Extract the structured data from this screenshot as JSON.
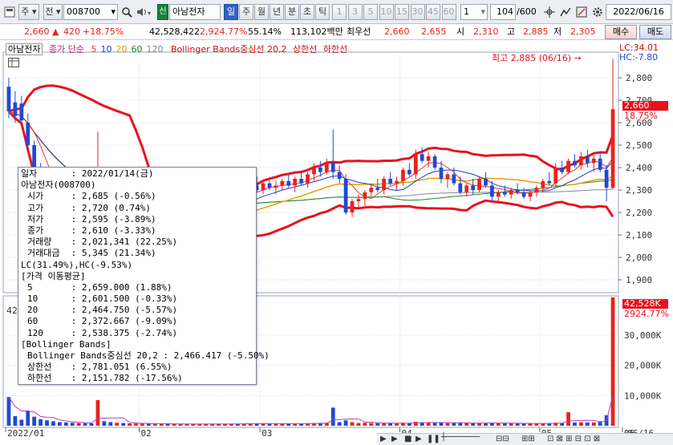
{
  "toolbar": {
    "market": "주",
    "prev": "전",
    "code": "008700",
    "new_badge": "신",
    "name": "아남전자",
    "periods": [
      "일",
      "주",
      "월",
      "년",
      "분",
      "초",
      "틱"
    ],
    "active_period": "일",
    "intervals": [
      "1",
      "3",
      "5",
      "10",
      "15",
      "30",
      "45",
      "60"
    ],
    "interval_value": "1",
    "count": "104",
    "count_max": "/600",
    "date": "2022/06/16"
  },
  "quote": {
    "price": "2,660",
    "change": "420",
    "change_pct": "+18.75%",
    "volume": "42,528,422",
    "volume_pct": "2,924.77%",
    "turnover": "55.14%",
    "amount": "113,102백만",
    "best_ask_label": "최우선",
    "best_ask": "2,660",
    "best_bid": "2,655",
    "open_label": "시",
    "open": "2,310",
    "high_label": "고",
    "high": "2,885",
    "low_label": "저",
    "low": "2,305",
    "buy": "매수",
    "sell": "매도"
  },
  "legend": {
    "stock": "아남전자",
    "ma_label": "종가 단순",
    "ma": [
      "5",
      "10",
      "20",
      "60",
      "120"
    ],
    "bb": "Bollinger Bands중심선 20,2",
    "upper": "상한선",
    "lower": "하한선"
  },
  "annotations": {
    "high_marker": "최고 2,885 (06/16)",
    "lc": "LC:34.01",
    "hc": "HC:-7.80",
    "price_tag": "2,660",
    "price_pct": "18.75%",
    "vol_tag": "42,528K",
    "vol_pct": "2924.77%",
    "vol_side": "42"
  },
  "axes": {
    "price_ticks": [
      "2,800",
      "2,700",
      "2,600",
      "2,500",
      "2,400",
      "2,300",
      "2,200",
      "2,100",
      "2,000",
      "1,900"
    ],
    "volume_ticks": [
      "30,000K",
      "20,000K",
      "10,000K"
    ],
    "x_ticks": [
      "2022/01",
      "02",
      "03",
      "04",
      "05",
      "06"
    ],
    "x_end": "06/16"
  },
  "info": {
    "date_label": "일자",
    "date": "2022/01/14(금)",
    "stock": "아남전자(008700)",
    "ohlc": [
      {
        "label": "시가",
        "value": "2,685 (-0.56%)"
      },
      {
        "label": "고가",
        "value": "2,720 (0.74%)"
      },
      {
        "label": "저가",
        "value": "2,595 (-3.89%)"
      },
      {
        "label": "종가",
        "value": "2,610 (-3.33%)"
      },
      {
        "label": "거래량",
        "value": "2,021,341 (22.25%)"
      },
      {
        "label": "거래대금",
        "value": "5,345 (21.34%)"
      }
    ],
    "lchc": "LC(31.49%),HC(-9.53%)",
    "ma_header": "[가격 이동평균]",
    "ma": [
      {
        "label": "5",
        "value": "2,659.000 (1.88%)"
      },
      {
        "label": "10",
        "value": "2,601.500 (-0.33%)"
      },
      {
        "label": "20",
        "value": "2,464.750 (-5.57%)"
      },
      {
        "label": "60",
        "value": "2,372.667 (-9.09%)"
      },
      {
        "label": "120",
        "value": "2,538.375 (-2.74%)"
      }
    ],
    "bb_header": "[Bollinger Bands]",
    "bb_center": "Bollinger Bands중심선 20,2 : 2,466.417 (-5.50%)",
    "bb_upper": {
      "label": "상한선",
      "value": "2,781.051 (6.55%)"
    },
    "bb_lower": {
      "label": "하한선",
      "value": "2,151.782 (-17.56%)"
    }
  },
  "colors": {
    "up": "#e8231c",
    "down": "#1f49d6",
    "ma5": "#e83a2c",
    "ma10": "#1c3bd4",
    "ma20": "#e6a000",
    "ma60": "#1a8a3a",
    "ma120": "#888888",
    "bb": "#e8121e"
  },
  "chart_data": {
    "type": "candlestick",
    "y_range": [
      1850,
      2900
    ],
    "volume_range": [
      0,
      43000
    ],
    "candles": [
      [
        2760,
        2800,
        2620,
        2650,
        9500
      ],
      [
        2690,
        2740,
        2600,
        2630,
        3200
      ],
      [
        2685,
        2720,
        2595,
        2610,
        2000
      ],
      [
        2600,
        2640,
        2480,
        2500,
        5000
      ],
      [
        2500,
        2520,
        2380,
        2400,
        3000
      ],
      [
        2390,
        2420,
        2320,
        2340,
        2200
      ],
      [
        2340,
        2360,
        2260,
        2280,
        1800
      ],
      [
        2280,
        2300,
        2200,
        2230,
        1500
      ],
      [
        2230,
        2260,
        2180,
        2200,
        1200
      ],
      [
        2200,
        2230,
        2150,
        2170,
        1100
      ],
      [
        2170,
        2200,
        2120,
        2150,
        1000
      ],
      [
        2150,
        2190,
        2130,
        2170,
        900
      ],
      [
        2170,
        2200,
        2140,
        2150,
        850
      ],
      [
        2150,
        2180,
        2120,
        2140,
        800
      ],
      [
        2140,
        2560,
        2130,
        2190,
        8500
      ],
      [
        2190,
        2210,
        2150,
        2160,
        1500
      ],
      [
        2160,
        2180,
        2110,
        2120,
        1200
      ],
      [
        2120,
        2150,
        2090,
        2130,
        1000
      ],
      [
        2130,
        2160,
        2100,
        2110,
        900
      ],
      [
        2110,
        2140,
        2080,
        2120,
        800
      ],
      [
        2120,
        2150,
        2100,
        2140,
        750
      ],
      [
        2140,
        2170,
        2110,
        2150,
        700
      ],
      [
        2150,
        2180,
        2120,
        2130,
        700
      ],
      [
        2130,
        2160,
        2100,
        2140,
        650
      ],
      [
        2140,
        2170,
        2120,
        2160,
        650
      ],
      [
        2160,
        2190,
        2140,
        2150,
        600
      ],
      [
        2150,
        2180,
        2130,
        2170,
        600
      ],
      [
        2170,
        2200,
        2150,
        2180,
        600
      ],
      [
        2180,
        2210,
        2160,
        2190,
        600
      ],
      [
        2190,
        2220,
        2170,
        2200,
        600
      ],
      [
        2200,
        2230,
        2180,
        2210,
        600
      ],
      [
        2210,
        2240,
        2190,
        2220,
        600
      ],
      [
        2220,
        2250,
        2200,
        2230,
        600
      ],
      [
        2230,
        2260,
        2210,
        2240,
        600
      ],
      [
        2240,
        2270,
        2220,
        2250,
        600
      ],
      [
        2250,
        2290,
        2230,
        2280,
        700
      ],
      [
        2280,
        2310,
        2250,
        2260,
        650
      ],
      [
        2260,
        2300,
        2240,
        2290,
        700
      ],
      [
        2290,
        2330,
        2270,
        2320,
        800
      ],
      [
        2320,
        2360,
        2290,
        2300,
        750
      ],
      [
        2300,
        2340,
        2280,
        2330,
        700
      ],
      [
        2330,
        2350,
        2300,
        2310,
        650
      ],
      [
        2310,
        2340,
        2280,
        2320,
        650
      ],
      [
        2320,
        2350,
        2300,
        2340,
        700
      ],
      [
        2340,
        2370,
        2310,
        2320,
        700
      ],
      [
        2320,
        2360,
        2290,
        2350,
        750
      ],
      [
        2350,
        2380,
        2320,
        2330,
        700
      ],
      [
        2330,
        2380,
        2310,
        2370,
        800
      ],
      [
        2370,
        2420,
        2340,
        2400,
        900
      ],
      [
        2400,
        2430,
        2360,
        2380,
        900
      ],
      [
        2380,
        2440,
        2370,
        2420,
        1000
      ],
      [
        2420,
        2570,
        2350,
        2380,
        6000
      ],
      [
        2380,
        2410,
        2330,
        2350,
        1200
      ],
      [
        2350,
        2370,
        2190,
        2200,
        1800
      ],
      [
        2200,
        2260,
        2180,
        2250,
        1200
      ],
      [
        2250,
        2280,
        2220,
        2260,
        900
      ],
      [
        2260,
        2300,
        2230,
        2290,
        1000
      ],
      [
        2290,
        2330,
        2270,
        2310,
        900
      ],
      [
        2310,
        2350,
        2290,
        2300,
        850
      ],
      [
        2300,
        2360,
        2280,
        2350,
        900
      ],
      [
        2350,
        2380,
        2320,
        2330,
        800
      ],
      [
        2330,
        2360,
        2300,
        2340,
        800
      ],
      [
        2340,
        2400,
        2320,
        2390,
        1000
      ],
      [
        2390,
        2420,
        2360,
        2370,
        900
      ],
      [
        2370,
        2480,
        2350,
        2460,
        1300
      ],
      [
        2460,
        2490,
        2420,
        2430,
        1100
      ],
      [
        2430,
        2470,
        2400,
        2450,
        1000
      ],
      [
        2450,
        2460,
        2390,
        2400,
        1000
      ],
      [
        2400,
        2430,
        2330,
        2350,
        1100
      ],
      [
        2350,
        2380,
        2310,
        2370,
        900
      ],
      [
        2370,
        2400,
        2320,
        2330,
        900
      ],
      [
        2330,
        2360,
        2280,
        2290,
        1000
      ],
      [
        2290,
        2330,
        2270,
        2320,
        900
      ],
      [
        2320,
        2350,
        2280,
        2300,
        850
      ],
      [
        2300,
        2360,
        2290,
        2350,
        900
      ],
      [
        2350,
        2380,
        2310,
        2320,
        850
      ],
      [
        2320,
        2340,
        2250,
        2270,
        1000
      ],
      [
        2270,
        2300,
        2240,
        2290,
        900
      ],
      [
        2290,
        2320,
        2270,
        2280,
        800
      ],
      [
        2280,
        2310,
        2260,
        2300,
        800
      ],
      [
        2300,
        2330,
        2280,
        2290,
        750
      ],
      [
        2290,
        2310,
        2260,
        2270,
        750
      ],
      [
        2270,
        2300,
        2250,
        2290,
        750
      ],
      [
        2290,
        2320,
        2270,
        2310,
        750
      ],
      [
        2310,
        2350,
        2290,
        2340,
        800
      ],
      [
        2340,
        2380,
        2320,
        2330,
        800
      ],
      [
        2330,
        2420,
        2320,
        2400,
        1000
      ],
      [
        2400,
        2430,
        2370,
        2380,
        900
      ],
      [
        2380,
        2440,
        2370,
        2430,
        4500
      ],
      [
        2430,
        2460,
        2400,
        2410,
        1100
      ],
      [
        2410,
        2470,
        2390,
        2450,
        1200
      ],
      [
        2450,
        2480,
        2400,
        2420,
        1100
      ],
      [
        2420,
        2460,
        2380,
        2440,
        1100
      ],
      [
        2440,
        2470,
        2380,
        2390,
        1500
      ],
      [
        2390,
        2410,
        2250,
        2310,
        3500
      ],
      [
        2310,
        2885,
        2305,
        2660,
        42528
      ]
    ]
  }
}
